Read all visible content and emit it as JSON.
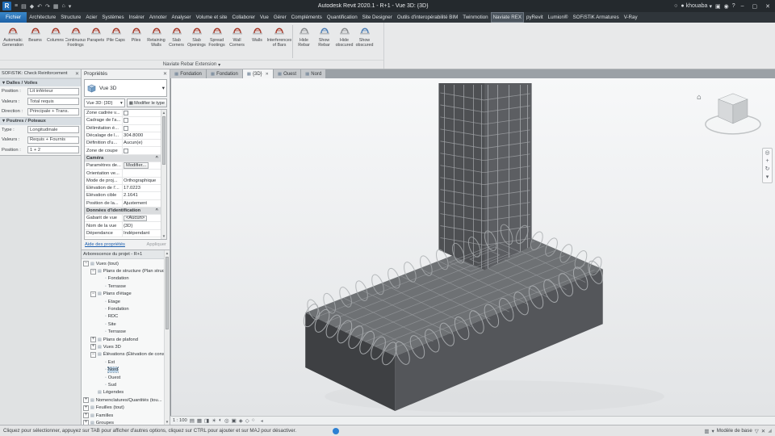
{
  "titlebar": {
    "title": "Autodesk Revit 2020.1 - R+1 - Vue 3D: {3D}",
    "user": "khouaba",
    "quick_access_icons": [
      "menu-icon",
      "open-icon",
      "save-icon",
      "undo-icon",
      "redo-icon",
      "print-icon",
      "measure-icon",
      "dropdown-icon"
    ],
    "right_icons": [
      "search-icon",
      "cart-icon",
      "bell-icon",
      "help-icon"
    ]
  },
  "ribbon_tabs": {
    "file_tab": "Fichier",
    "active": "Naviate REX",
    "tabs": [
      "Architecture",
      "Structure",
      "Acier",
      "Systèmes",
      "Insérer",
      "Annoter",
      "Analyser",
      "Volume et site",
      "Collaborer",
      "Vue",
      "Gérer",
      "Compléments",
      "Quantification",
      "Site Designer",
      "Outils d'interopérabilité BIM",
      "Twinmotion",
      "Naviate REX",
      "pyRevit",
      "Lumion®",
      "SOFiSTiK Armatures",
      "V-Ray"
    ]
  },
  "ribbon": {
    "panel_label": "Naviate Rebar Extension",
    "tools": [
      {
        "label": "Automatic Generation",
        "icon": "auto-generation-icon",
        "group": 1,
        "wide": true
      },
      {
        "label": "Beams",
        "icon": "beams-rebar-icon",
        "group": 1
      },
      {
        "label": "Columns",
        "icon": "columns-rebar-icon",
        "group": 1
      },
      {
        "label": "Continuous Footings",
        "icon": "continuous-footings-icon",
        "group": 1
      },
      {
        "label": "Parapets",
        "icon": "parapets-icon",
        "group": 1
      },
      {
        "label": "Pile Caps",
        "icon": "pile-caps-icon",
        "group": 1
      },
      {
        "label": "Piles",
        "icon": "piles-icon",
        "group": 1
      },
      {
        "label": "Retaining Walls",
        "icon": "retaining-walls-icon",
        "group": 1
      },
      {
        "label": "Slab Corners",
        "icon": "slab-corners-icon",
        "group": 1
      },
      {
        "label": "Slab Openings",
        "icon": "slab-openings-icon",
        "group": 1
      },
      {
        "label": "Spread Footings",
        "icon": "spread-footings-icon",
        "group": 1
      },
      {
        "label": "Wall Corners",
        "icon": "wall-corners-icon",
        "group": 1
      },
      {
        "label": "Walls",
        "icon": "walls-rebar-icon",
        "group": 1
      },
      {
        "label": "Interferences of Bars",
        "icon": "interferences-icon",
        "group": 1,
        "wide": true
      },
      {
        "label": "Hide Rebar",
        "icon": "hide-rebar-icon",
        "group": 2
      },
      {
        "label": "Show Rebar",
        "icon": "show-rebar-icon",
        "group": 2
      },
      {
        "label": "Hide obscured",
        "icon": "hide-obscured-icon",
        "group": 2
      },
      {
        "label": "Show obscured",
        "icon": "show-obscured-icon",
        "group": 2
      }
    ]
  },
  "sofistik": {
    "title": "SOFiSTiK: Check Reinforcement",
    "sections": [
      {
        "title": "Dalles / Voiles",
        "rows": [
          {
            "label": "Position :",
            "value": "Lit inférieur"
          },
          {
            "label": "Valeurs :",
            "value": "Total requis"
          },
          {
            "label": "Direction :",
            "value": "Principale + Trans."
          }
        ]
      },
      {
        "title": "Poutres / Poteaux",
        "rows": [
          {
            "label": "Type :",
            "value": "Longitudinale"
          },
          {
            "label": "Valeurs :",
            "value": "Requis + Fournis"
          },
          {
            "label": "Position :",
            "value": "1 + 2"
          }
        ]
      }
    ]
  },
  "properties": {
    "title": "Propriétés",
    "type_selector": "Vue 3D",
    "instance_combo": "Vue 3D: {3D}",
    "edit_type_label": "Modifier le type",
    "rows": [
      {
        "label": "Zone cadrée v...",
        "type": "check"
      },
      {
        "label": "Cadrage de l'a...",
        "type": "check"
      },
      {
        "label": "Délimitation é...",
        "type": "check"
      },
      {
        "label": "Décalage de l...",
        "value": "304.8000"
      },
      {
        "label": "Définition d'u...",
        "value": "Aucun(e)"
      },
      {
        "label": "Zone de coupe",
        "type": "check"
      },
      {
        "label": "Caméra",
        "type": "section"
      },
      {
        "label": "Paramètres de...",
        "value": "Modifier...",
        "type": "button"
      },
      {
        "label": "Orientation ve...",
        "value": "",
        "type": "disabled"
      },
      {
        "label": "Mode de proj...",
        "value": "Orthographique"
      },
      {
        "label": "Élévation de l'...",
        "value": "17.0223"
      },
      {
        "label": "Élévation cible",
        "value": "2.1641"
      },
      {
        "label": "Position de la...",
        "value": "Ajustement"
      },
      {
        "label": "Données d'identification",
        "type": "section"
      },
      {
        "label": "Gabarit de vue",
        "value": "<Aucun>",
        "type": "button"
      },
      {
        "label": "Nom de la vue",
        "value": "{3D}"
      },
      {
        "label": "Dépendance",
        "value": "Indépendant"
      }
    ],
    "help_link": "Aide des propriétés",
    "apply_label": "Appliquer"
  },
  "browser": {
    "title": "Arborescence du projet - R+1",
    "tree": [
      {
        "d": 0,
        "e": "-",
        "label": "Vues (tout)"
      },
      {
        "d": 1,
        "e": "-",
        "label": "Plans de structure (Plan struc..."
      },
      {
        "d": 2,
        "label": "Fondation"
      },
      {
        "d": 2,
        "label": "Terrasse"
      },
      {
        "d": 1,
        "e": "-",
        "label": "Plans d'étage"
      },
      {
        "d": 2,
        "label": "Etage"
      },
      {
        "d": 2,
        "label": "Fondation"
      },
      {
        "d": 2,
        "label": "RDC"
      },
      {
        "d": 2,
        "label": "Site"
      },
      {
        "d": 2,
        "label": "Terrasse"
      },
      {
        "d": 1,
        "e": "+",
        "label": "Plans de plafond"
      },
      {
        "d": 1,
        "e": "+",
        "label": "Vues 3D"
      },
      {
        "d": 1,
        "e": "-",
        "label": "Élévations (Élévation de const..."
      },
      {
        "d": 2,
        "label": "Est"
      },
      {
        "d": 2,
        "label": "Nord",
        "selected": true
      },
      {
        "d": 2,
        "label": "Ouest"
      },
      {
        "d": 2,
        "label": "Sud"
      },
      {
        "d": 1,
        "label": "Légendes"
      },
      {
        "d": 0,
        "e": "+",
        "label": "Nomenclatures/Quantités (tou..."
      },
      {
        "d": 0,
        "e": "+",
        "label": "Feuilles (tout)"
      },
      {
        "d": 0,
        "e": "+",
        "label": "Familles"
      },
      {
        "d": 0,
        "e": "+",
        "label": "Groupes"
      }
    ]
  },
  "view_tabs": [
    {
      "label": "Fondation"
    },
    {
      "label": "Fondation"
    },
    {
      "label": "{3D}",
      "active": true,
      "closable": true
    },
    {
      "label": "Ouest"
    },
    {
      "label": "Nord"
    }
  ],
  "viewport": {
    "scale": "1 : 100",
    "view_control_icons": [
      "thin-lines-icon",
      "detail-level-icon",
      "visual-style-icon",
      "sun-path-icon",
      "shadows-icon",
      "render-icon",
      "crop-view-icon",
      "crop-region-icon",
      "lock-view-icon",
      "isolate-icon"
    ],
    "navbar_icons": [
      "steering-wheel-icon",
      "pan-icon",
      "orbit-icon",
      "nav-more-icon"
    ]
  },
  "statusbar": {
    "hint": "Cliquez pour sélectionner, appuyez sur TAB pour afficher d'autres options, cliquez sur CTRL pour ajouter et sur MAJ pour désactiver.",
    "model_label": "Modèle de base",
    "left_icons": [
      "worksets-icon",
      "editable-only-icon"
    ],
    "right_icons": [
      "filter-icon",
      "exclude-icon"
    ]
  }
}
